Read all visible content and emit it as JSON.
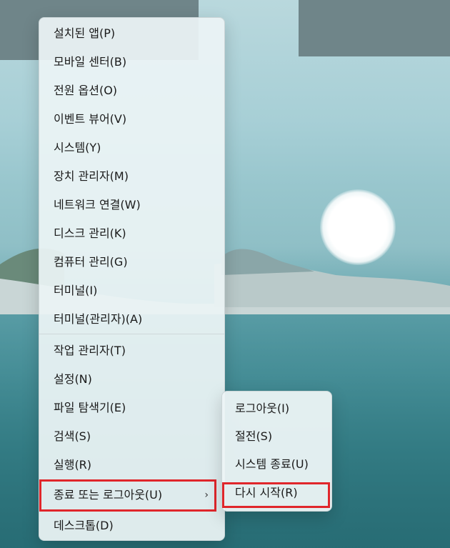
{
  "menu": {
    "items": [
      {
        "label": "설치된 앱(P)"
      },
      {
        "label": "모바일 센터(B)"
      },
      {
        "label": "전원 옵션(O)"
      },
      {
        "label": "이벤트 뷰어(V)"
      },
      {
        "label": "시스템(Y)"
      },
      {
        "label": "장치 관리자(M)"
      },
      {
        "label": "네트워크 연결(W)"
      },
      {
        "label": "디스크 관리(K)"
      },
      {
        "label": "컴퓨터 관리(G)"
      },
      {
        "label": "터미널(I)"
      },
      {
        "label": "터미널(관리자)(A)"
      },
      {
        "label": "작업 관리자(T)"
      },
      {
        "label": "설정(N)"
      },
      {
        "label": "파일 탐색기(E)"
      },
      {
        "label": "검색(S)"
      },
      {
        "label": "실행(R)"
      },
      {
        "label": "종료 또는 로그아웃(U)",
        "chevron": "›"
      },
      {
        "label": "데스크톱(D)"
      }
    ]
  },
  "submenu": {
    "items": [
      {
        "label": "로그아웃(I)"
      },
      {
        "label": "절전(S)"
      },
      {
        "label": "시스템 종료(U)"
      },
      {
        "label": "다시 시작(R)"
      }
    ]
  },
  "highlight_color": "#e0262b"
}
